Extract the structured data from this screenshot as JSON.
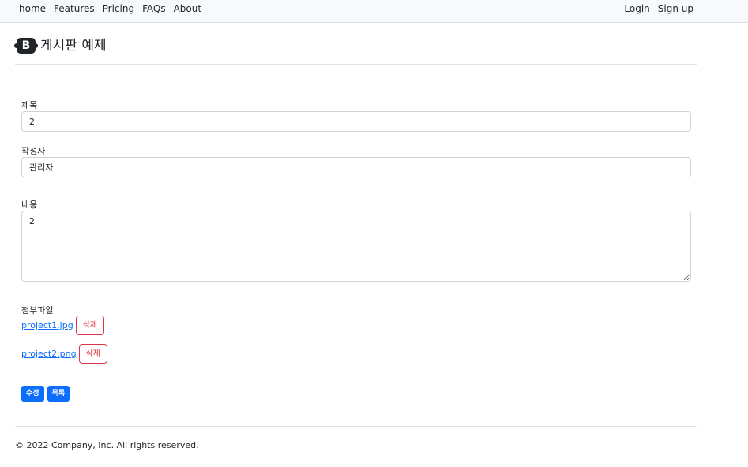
{
  "nav": {
    "links": [
      "home",
      "Features",
      "Pricing",
      "FAQs",
      "About"
    ],
    "login": "Login",
    "signup": "Sign up"
  },
  "header": {
    "logo_text": "B",
    "title": "게시판 예제"
  },
  "form": {
    "title_label": "제목",
    "title_value": "2",
    "writer_label": "작성자",
    "writer_value": "관리자",
    "content_label": "내용",
    "content_value": "2",
    "attach_label": "첨부파일",
    "files": [
      {
        "name": "project1.jpg",
        "delete_label": "삭제"
      },
      {
        "name": "project2.png",
        "delete_label": "삭제"
      }
    ],
    "edit_label": "수정",
    "list_label": "목록"
  },
  "footer": {
    "copyright": "© 2022 Company, Inc. All rights reserved."
  },
  "colors": {
    "primary": "#0d6efd",
    "danger": "#dc3545",
    "navbar_bg": "#f8f9fa"
  }
}
